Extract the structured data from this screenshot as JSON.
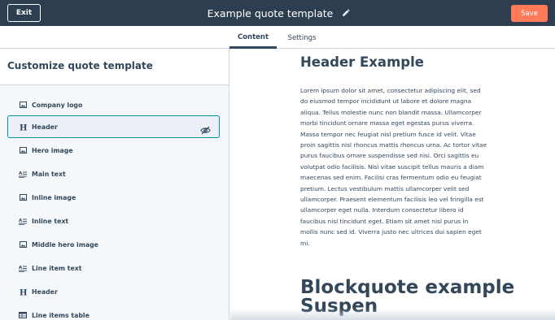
{
  "topbar": {
    "exit_label": "Exit",
    "title": "Example quote template",
    "save_label": "Save",
    "save_color": "#ff7a59",
    "bg_color": "#2d3e50"
  },
  "tabs": [
    {
      "label": "Content",
      "active": true
    },
    {
      "label": "Settings",
      "active": false
    }
  ],
  "sidebar": {
    "title": "Customize quote template",
    "items": [
      {
        "label": "Company logo",
        "icon": "image-icon"
      },
      {
        "label": "Header",
        "icon": "heading-icon",
        "selected": true
      },
      {
        "label": "Hero image",
        "icon": "image-icon"
      },
      {
        "label": "Main text",
        "icon": "text-icon"
      },
      {
        "label": "Inline image",
        "icon": "image-icon"
      },
      {
        "label": "Inline text",
        "icon": "text-icon"
      },
      {
        "label": "Middle hero image",
        "icon": "image-icon"
      },
      {
        "label": "Line item text",
        "icon": "text-icon"
      },
      {
        "label": "Header",
        "icon": "heading-icon"
      },
      {
        "label": "Line items table",
        "icon": "table-icon"
      }
    ]
  },
  "preview": {
    "heading": "Header Example",
    "body": "Lorem ipsum dolor sit amet, consectetur adipiscing elit, sed do eiusmod tempor incididunt ut labore et dolore magna aliqua. Tellus molestie nunc non blandit massa. Ullamcorper morbi tincidunt ornare massa eget egestas purus viverra. Massa tempor nec feugiat nisl pretium fusce id velit. Vitae proin sagittis nisl rhoncus mattis rhoncus urna. Ac tortor vitae purus faucibus ornare suspendisse sed nisi. Orci sagittis eu volutpat odio facilisis. Nisi vitae suscipit tellus mauris a diam maecenas sed enim. Facilisi cras fermentum odio eu feugiat pretium. Lectus vestibulum mattis ullamcorper velit sed ullamcorper. Praesent elementum facilisis leo vel fringilla est ullamcorper eget nulla. Interdum consectetur libero id faucibus nisl tincidunt eget. Etiam sit amet nisl purus in mollis nunc sed id. Viverra justo nec ultrices dui sapien eget mi.",
    "blockquote": "Blockquote example Suspen"
  }
}
